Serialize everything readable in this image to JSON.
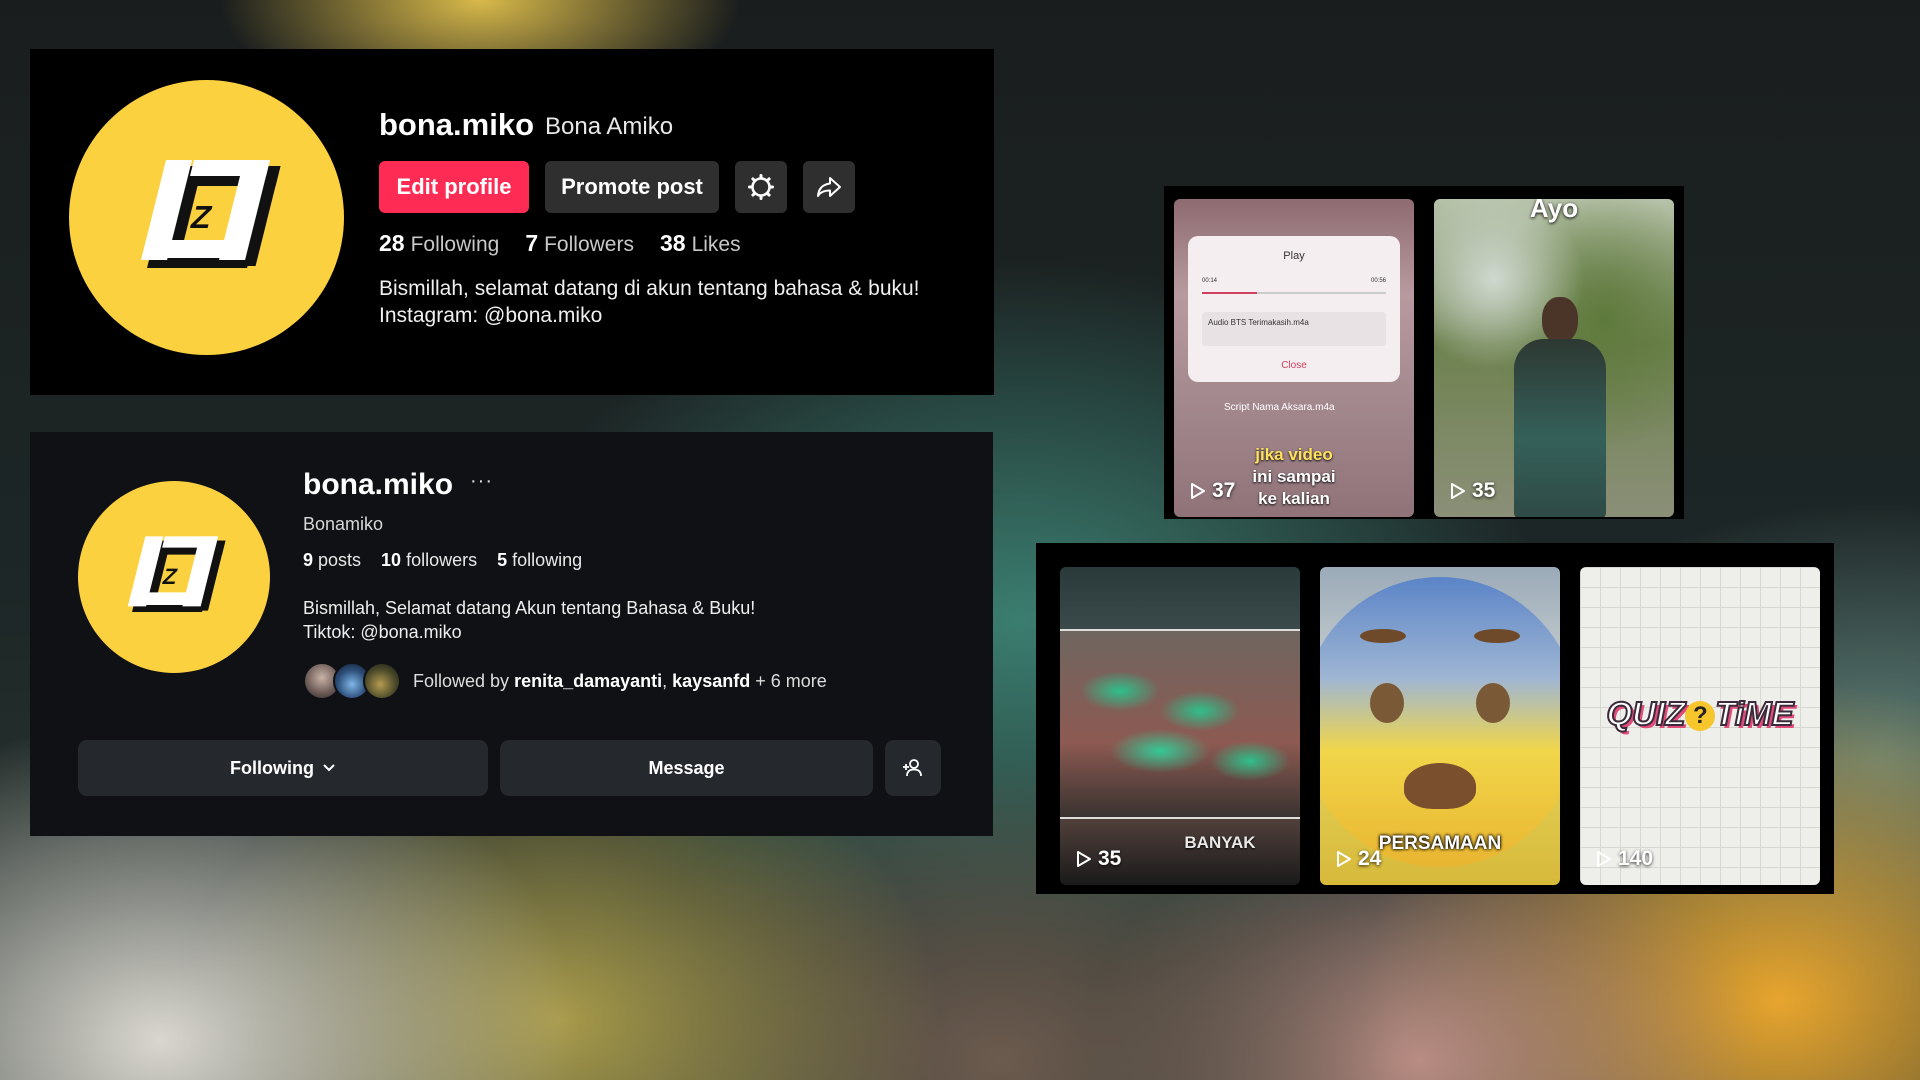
{
  "tiktok": {
    "username": "bona.miko",
    "nickname": "Bona Amiko",
    "edit_label": "Edit profile",
    "promote_label": "Promote post",
    "stats": [
      {
        "value": "28",
        "label": "Following"
      },
      {
        "value": "7",
        "label": "Followers"
      },
      {
        "value": "38",
        "label": "Likes"
      }
    ],
    "bio_line1": "Bismillah, selamat datang di akun tentang bahasa & buku!",
    "bio_line2": "Instagram: @bona.miko",
    "accent": "#fe2c55"
  },
  "instagram": {
    "username": "bona.miko",
    "more": "···",
    "real_name": "Bonamiko",
    "posts_value": "9",
    "posts_label": "posts",
    "followers_value": "10",
    "followers_label": "followers",
    "following_value": "5",
    "following_label": "following",
    "bio_line1": "Bismillah, Selamat datang Akun tentang Bahasa & Buku!",
    "bio_line2": "Tiktok: @bona.miko",
    "followed_by_prefix": "Followed by",
    "followed_by_user1": "renita_damayanti",
    "followed_by_sep": ",",
    "followed_by_user2": "kaysanfd",
    "followed_by_more": "+ 6 more",
    "following_button": "Following",
    "message_button": "Message"
  },
  "videos_top": [
    {
      "views": "37",
      "dialog_title": "Play",
      "dialog_file": "Audio BTS Terimakasih.m4a",
      "dialog_time_start": "00:14",
      "dialog_time_end": "00:56",
      "dialog_close": "Close",
      "list_item": "Script Nama Aksara.m4a",
      "caption_line1": "jika video",
      "caption_line2": "ini sampai",
      "caption_line3": "ke kalian"
    },
    {
      "views": "35",
      "caption": "Ayo"
    }
  ],
  "videos_bottom": [
    {
      "views": "35",
      "caption": "BANYAK"
    },
    {
      "views": "24",
      "caption": "PERSAMAAN"
    },
    {
      "views": "140",
      "caption_left": "QUIZ",
      "caption_mark": "?",
      "caption_right": "TiME"
    }
  ],
  "icons": [
    "tiktok-avatar-logo",
    "settings-icon",
    "share-icon",
    "more-icon",
    "chevron-down-icon",
    "add-user-icon",
    "play-icon"
  ]
}
